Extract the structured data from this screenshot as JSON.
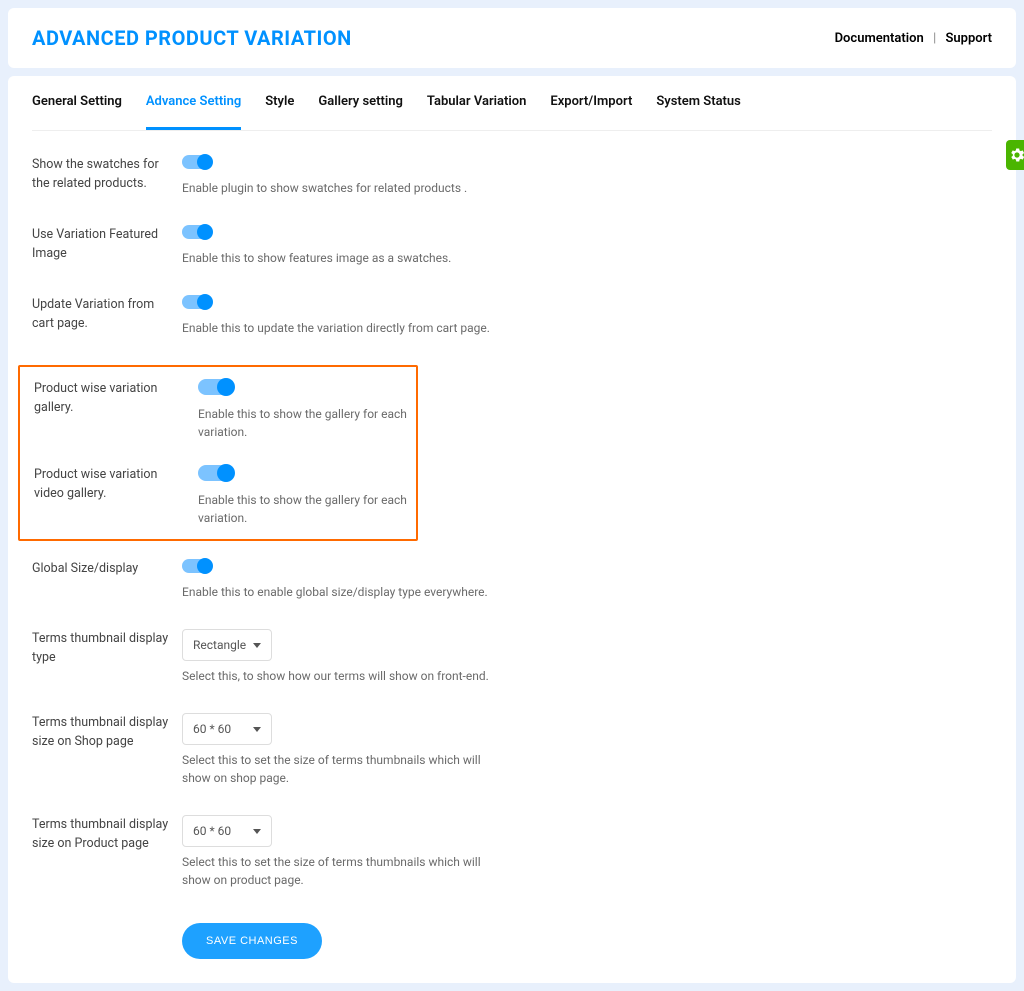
{
  "header": {
    "title": "ADVANCED PRODUCT VARIATION",
    "links": {
      "documentation": "Documentation",
      "support": "Support"
    }
  },
  "tabs": [
    {
      "label": "General Setting",
      "active": false
    },
    {
      "label": "Advance Setting",
      "active": true
    },
    {
      "label": "Style",
      "active": false
    },
    {
      "label": "Gallery setting",
      "active": false
    },
    {
      "label": "Tabular Variation",
      "active": false
    },
    {
      "label": "Export/Import",
      "active": false
    },
    {
      "label": "System Status",
      "active": false
    }
  ],
  "settings": {
    "swatches_related": {
      "label": "Show the swatches for the related products.",
      "desc": "Enable plugin to show swatches for related products .",
      "on": true
    },
    "variation_featured": {
      "label": "Use Variation Featured Image",
      "desc": "Enable this to show features image as a swatches.",
      "on": true
    },
    "update_variation_cart": {
      "label": "Update Variation from cart page.",
      "desc": "Enable this to update the variation directly from cart page.",
      "on": true
    },
    "product_gallery": {
      "label": "Product wise variation gallery.",
      "desc": "Enable this to show the gallery for each variation.",
      "on": true
    },
    "product_video_gallery": {
      "label": "Product wise variation video gallery.",
      "desc": "Enable this to show the gallery for each variation.",
      "on": true
    },
    "global_size": {
      "label": "Global Size/display",
      "desc": "Enable this to enable global size/display type everywhere.",
      "on": true
    },
    "thumb_display_type": {
      "label": "Terms thumbnail display type",
      "value": "Rectangle",
      "desc": "Select this, to show how our terms will show on front-end."
    },
    "thumb_size_shop": {
      "label": "Terms thumbnail display size on Shop page",
      "value": "60 * 60",
      "desc": "Select this to set the size of terms thumbnails which will show on shop page."
    },
    "thumb_size_product": {
      "label": "Terms thumbnail display size on Product page",
      "value": "60 * 60",
      "desc": "Select this to set the size of terms thumbnails which will show on product page."
    }
  },
  "actions": {
    "save": "SAVE CHANGES"
  },
  "icons": {
    "gear": "settings-gear"
  }
}
